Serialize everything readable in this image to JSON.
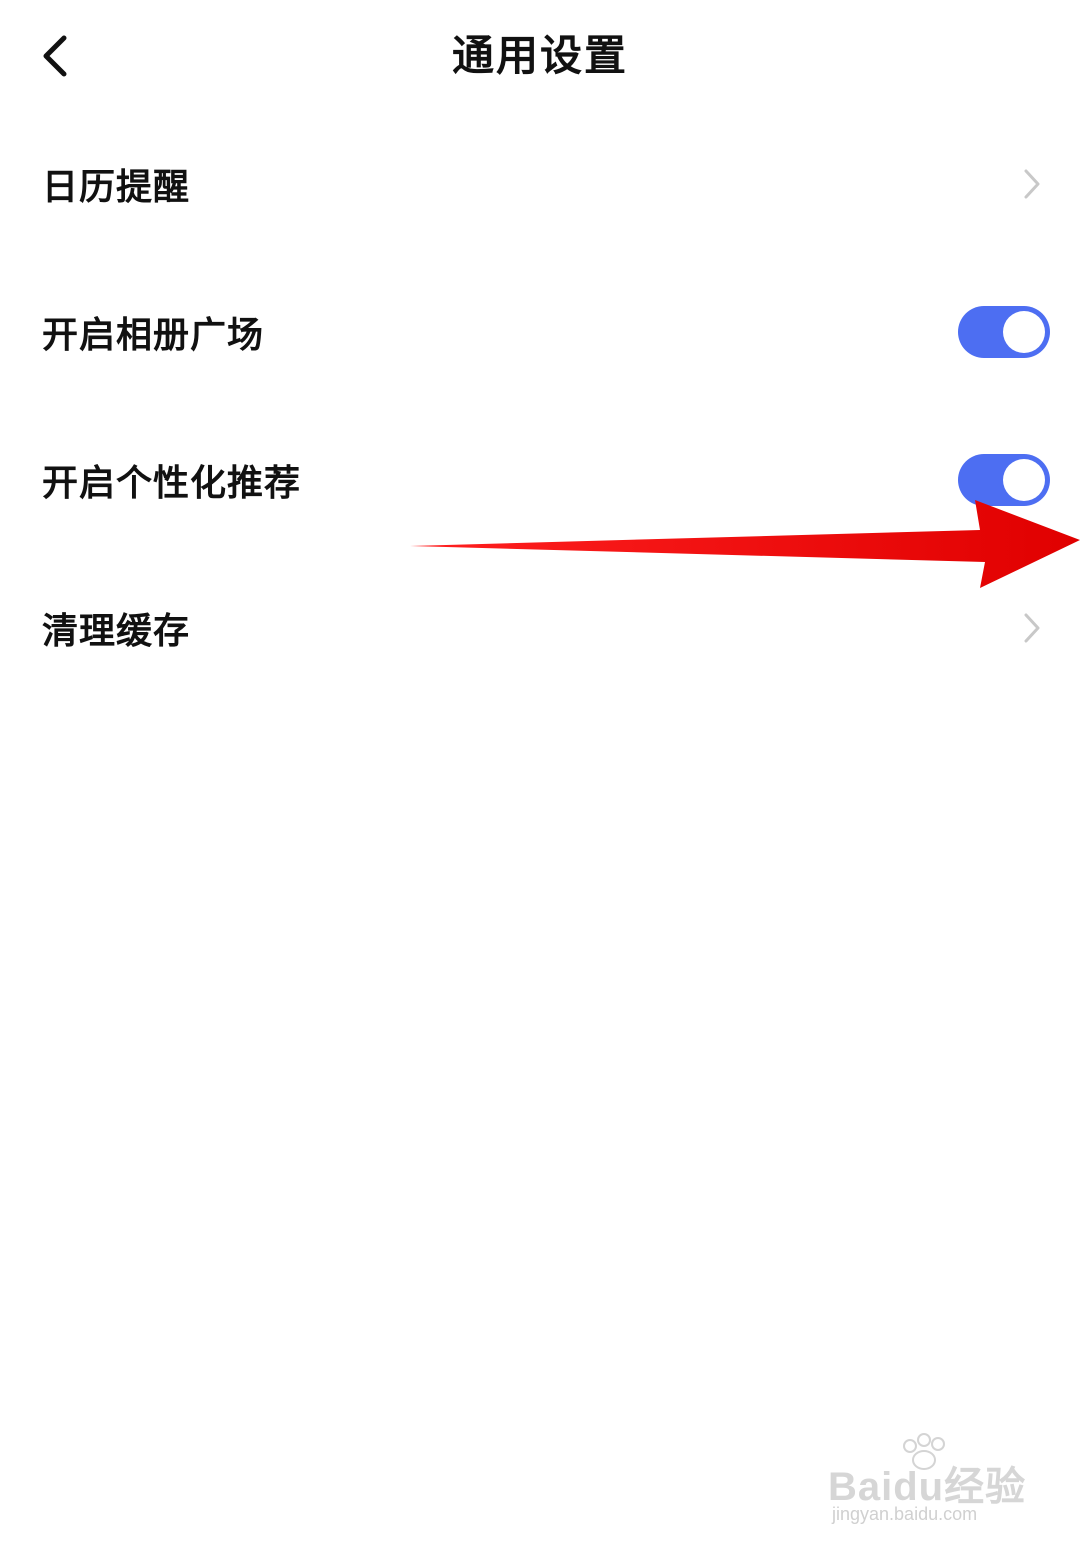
{
  "nav": {
    "title": "通用设置",
    "back_icon": "chevron-left-icon"
  },
  "settings": {
    "calendar_reminder": {
      "label": "日历提醒",
      "control": "chevron-right-icon"
    },
    "album_plaza": {
      "label": "开启相册广场",
      "enabled": true
    },
    "personalized_recommend": {
      "label": "开启个性化推荐",
      "enabled": true
    },
    "clear_cache": {
      "label": "清理缓存",
      "control": "chevron-right-icon"
    }
  },
  "colors": {
    "toggle_on": "#4d6ef2",
    "arrow": "#ee1111",
    "chevron": "#c8c8c8"
  },
  "watermark": {
    "brand": "Baidu经验",
    "url": "jingyan.baidu.com"
  }
}
